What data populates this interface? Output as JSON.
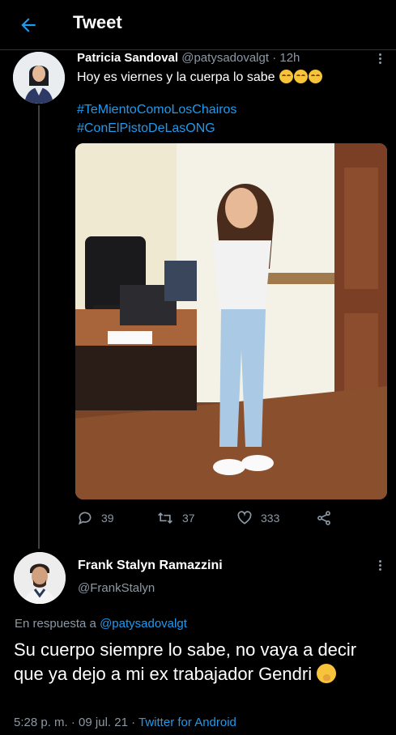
{
  "header": {
    "title": "Tweet"
  },
  "tweet": {
    "author_name": "Patricia Sandoval",
    "author_handle": "@patysadovalgt",
    "separator": "·",
    "time": "12h",
    "text": "Hoy es viernes y la cuerpa lo sabe",
    "hashtags": [
      "#TeMientoComoLosChairos",
      "#ConElPistoDeLasONG"
    ],
    "replies": "39",
    "retweets": "37",
    "likes": "333"
  },
  "reply": {
    "author_name": "Frank Stalyn Ramazzini",
    "author_handle": "@FrankStalyn",
    "in_reply_prefix": "En respuesta a",
    "in_reply_handle": "@patysadovalgt",
    "text": "Su cuerpo siempre lo sabe, no vaya a decir que ya dejo a mi ex trabajador Gendri",
    "time": "5:28 p. m.",
    "separator1": "·",
    "date": "09 jul. 21",
    "separator2": "·",
    "source": "Twitter for Android"
  },
  "colors": {
    "accent": "#1d9bf0",
    "muted": "#8b98a5",
    "background": "#000000"
  },
  "icons": [
    "back-arrow-icon",
    "more-icon",
    "reply-icon",
    "retweet-icon",
    "like-icon",
    "share-icon"
  ]
}
